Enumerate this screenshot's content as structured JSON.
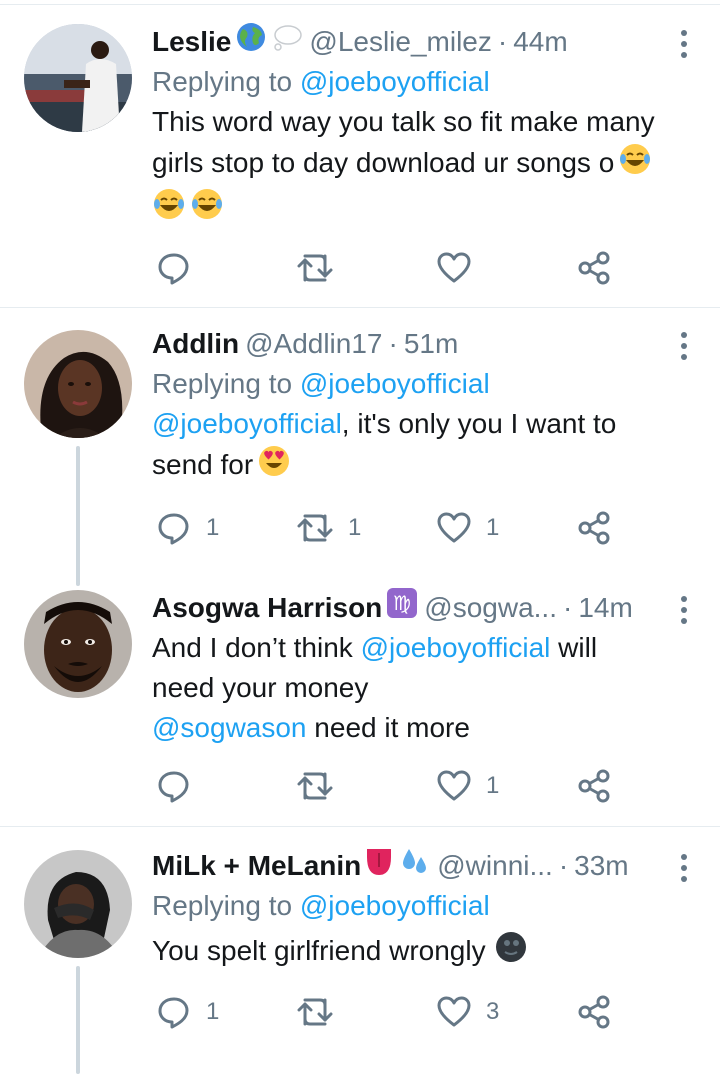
{
  "tweets": [
    {
      "name": "Leslie",
      "name_emojis": [
        "globe-emoji",
        "thought-bubble-emoji"
      ],
      "handle": "@Leslie_milez",
      "time": "44m",
      "replying_prefix": "Replying to ",
      "replying_to": "@joeboyofficial",
      "text_line1": "This word way you talk so fit make many",
      "text_line2": "girls stop to day download ur songs o",
      "text_emojis": [
        "laughing-emoji",
        "laughing-emoji",
        "laughing-emoji"
      ],
      "replies": "",
      "retweets": "",
      "likes": ""
    },
    {
      "name": "Addlin",
      "handle": "@Addlin17",
      "time": "51m",
      "replying_prefix": "Replying to ",
      "replying_to": "@joeboyofficial",
      "mention": "@joeboyofficial",
      "text_line1": ", it's only you I want to",
      "text_line2": "send for",
      "text_emojis": [
        "heart-eyes-emoji"
      ],
      "replies": "1",
      "retweets": "1",
      "likes": "1"
    },
    {
      "name": "Asogwa Harrison",
      "name_emojis": [
        "virgo-emoji"
      ],
      "handle": "@sogwa...",
      "time": "14m",
      "text_line1_prefix": "And I don’t think ",
      "text_line1_mention": "@joeboyofficial",
      "text_line1_suffix": " will",
      "text_line2": "need your money",
      "text_line3_mention": "@sogwason",
      "text_line3_suffix": " need it more",
      "replies": "",
      "retweets": "",
      "likes": "1"
    },
    {
      "name": "MiLk + MeLanin",
      "name_emojis": [
        "tongue-emoji",
        "sweat-droplets-emoji"
      ],
      "handle": "@winni...",
      "time": "33m",
      "replying_prefix": "Replying to ",
      "replying_to": "@joeboyofficial",
      "text_line1": "You spelt girlfriend wrongly",
      "text_emojis": [
        "new-moon-face-emoji"
      ],
      "replies": "1",
      "retweets": "",
      "likes": "3"
    }
  ],
  "icons": {
    "reply": "reply-icon",
    "retweet": "retweet-icon",
    "like": "heart-icon",
    "share": "share-icon",
    "more": "more-icon"
  },
  "colors": {
    "link": "#1da1f2",
    "secondary": "#657786",
    "primary_text": "#14171a",
    "divider": "#e6ecf0",
    "thread_line": "#ccd6dd"
  }
}
